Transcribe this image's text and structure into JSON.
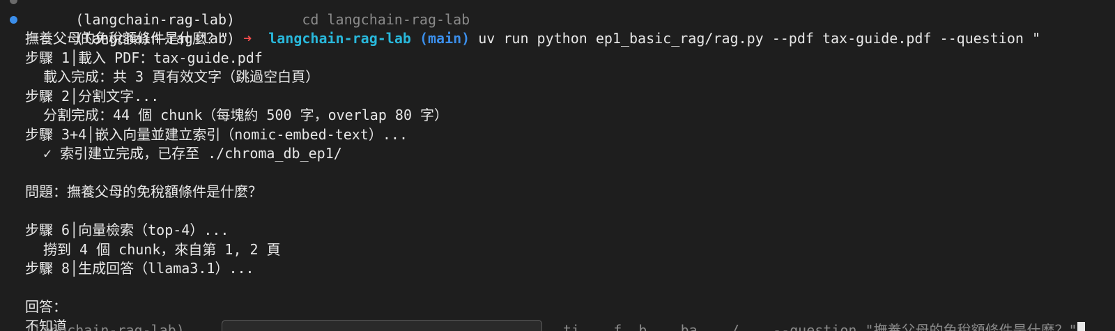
{
  "prev_prompt": {
    "venv": "(langchain-rag-lab)",
    "text": "cd langchain-rag-lab"
  },
  "prompt": {
    "venv": "(langchain-rag-lab)",
    "arrow": "➜",
    "repo": "langchain-rag-lab",
    "branch": "(main)",
    "command": "uv run python ep1_basic_rag/rag.py --pdf tax-guide.pdf --question \"",
    "command_cont": "撫養父母的免稅額條件是什麼？\""
  },
  "output": {
    "step1": "步驟 1│載入 PDF：tax-guide.pdf",
    "step1_result": "載入完成：共 3 頁有效文字（跳過空白頁）",
    "step2": "步驟 2│分割文字...",
    "step2_result": "分割完成：44 個 chunk（每塊約 500 字，overlap 80 字）",
    "step34": "步驟 3+4│嵌入向量並建立索引（nomic-embed-text）...",
    "step34_result": "✓ 索引建立完成，已存至 ./chroma_db_ep1/",
    "question": "問題：撫養父母的免稅額條件是什麼？",
    "step6": "步驟 6│向量檢索（top-4）...",
    "step6_result": "撈到 4 個 chunk，來自第 1, 2 頁",
    "step8": "步驟 8│生成回答（llama3.1）...",
    "answer_label": "回答：",
    "answer": "不知道"
  },
  "next_prompt": {
    "venv": "(langchain-rag-lab)",
    "suggestion_tail": "ti    f  b    ba    /    --question \"撫養父母的免稅額條件是什麼？\""
  },
  "colors": {
    "background": "#1e1e1e",
    "text": "#e7e7e7",
    "marker": "#3b8eea",
    "arrow": "#f14c4c",
    "repo": "#29b8db",
    "branch": "#3b8eea"
  }
}
